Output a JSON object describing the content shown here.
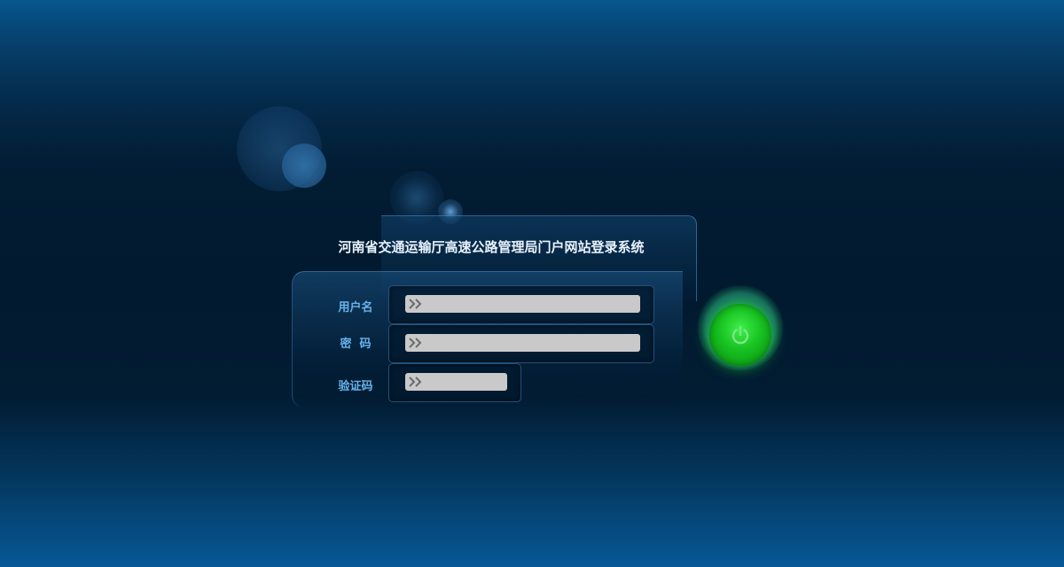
{
  "login": {
    "title": "河南省交通运输厅高速公路管理局门户网站登录系统",
    "username_label": "用户名",
    "password_label": "密  码",
    "captcha_label": "验证码",
    "username_value": "",
    "password_value": "",
    "captcha_value": ""
  },
  "icons": {
    "input_prefix": "chevron-double-right-icon",
    "submit": "power-icon"
  },
  "colors": {
    "background_dark": "#011a2f",
    "background_light": "#075897",
    "title_text": "#e8f2fb",
    "label_text": "#67b2ea",
    "input_fill": "#c9c9c9",
    "submit_button": "#16c020"
  }
}
